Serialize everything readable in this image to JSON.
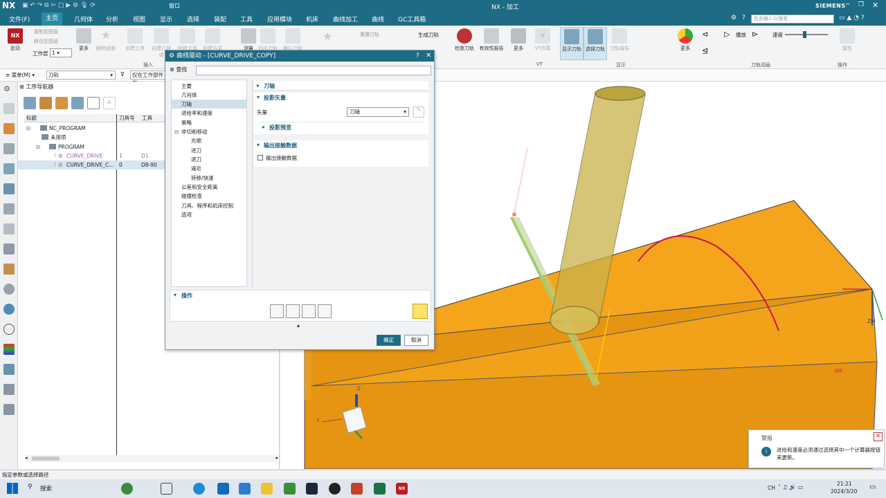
{
  "window": {
    "app_logo": "NX",
    "title": "NX - 加工",
    "brand": "SIEMENS",
    "search_placeholder": "在此输入以搜索",
    "window_menu": "窗口"
  },
  "menu": {
    "items": [
      "文件(F)",
      "主页",
      "几何体",
      "分析",
      "视图",
      "显示",
      "选择",
      "装配",
      "工具",
      "应用模块",
      "机床",
      "曲线加工",
      "曲线",
      "GC工具箱"
    ],
    "active": "主页"
  },
  "ribbon": {
    "launch": "启动",
    "workset_label": "工作层",
    "workset_value": "1",
    "more": "更多",
    "delete_group": "删除组面",
    "copy_plane": "复制至图层",
    "move_plane": "移动至图层",
    "create_op": "创建工序",
    "create_geo": "创建几何体",
    "create_tool": "创建刀具",
    "create_method": "创建方法",
    "measure": "测量",
    "list_op": "列出刀轨",
    "generate_path": "生成刀轨",
    "replay_path": "重播刀轨",
    "verify_path": "确认刀轨",
    "check_tool": "检查刀轨",
    "validity": "有效性报告",
    "more2": "更多",
    "vt_sim": "VT仿真",
    "show_path": "显示刀轨",
    "select_path": "选择刀轨",
    "path_report": "刀轨报告",
    "more3": "更多",
    "play": "播放",
    "speed": "速度",
    "attr": "属性",
    "group_insert": "插入",
    "group_vt": "VT",
    "group_display": "显示",
    "group_animation": "刀轨动画",
    "group_ops": "操作"
  },
  "cmdbar": {
    "menu": "菜单(M)",
    "filter1": "刀轨",
    "filter2": "仅在工作部件内"
  },
  "navigator": {
    "title": "工序导航器",
    "columns": [
      "标题",
      "刀具号",
      "工具"
    ],
    "rows": [
      {
        "name": "NC_PROGRAM",
        "num": "",
        "tool": "",
        "level": 0
      },
      {
        "name": "未用项",
        "num": "",
        "tool": "",
        "level": 1
      },
      {
        "name": "PROGRAM",
        "num": "",
        "tool": "",
        "level": 1
      },
      {
        "name": "CURVE_DRIVE",
        "num": "1",
        "tool": "D1",
        "level": 2
      },
      {
        "name": "CURVE_DRIVE_C...",
        "num": "0",
        "tool": "D8-90",
        "level": 2
      }
    ]
  },
  "dialog": {
    "title": "曲线驱动 - [CURVE_DRIVE_COPY]",
    "find_label": "查找",
    "nav": [
      "主要",
      "几何体",
      "刀轴",
      "进给率和速度",
      "策略",
      "非切削移动",
      "光顺",
      "进刀",
      "退刀",
      "逼近",
      "转移/快速",
      "公差和安全距离",
      "碰撞检查",
      "刀具、程序和机床控制",
      "选项"
    ],
    "nav_selected": "刀轴",
    "sec_tool_axis": "刀轴",
    "sec_proj_vec": "投影矢量",
    "vector_label": "矢量",
    "vector_value": "刀轴",
    "sec_proj_preview": "投影预览",
    "sec_output": "输出接触数据",
    "output_check": "输出接触数据",
    "sec_ops": "操作",
    "ok": "确定",
    "cancel": "取消"
  },
  "viewport": {
    "axis_zm": "ZM",
    "axis_xm": "XM",
    "axis_z": "Z",
    "axis_x": "X"
  },
  "alert": {
    "title": "警报",
    "message": "进给和速度必须通过选择其中一个计算器按钮来更新。"
  },
  "status": {
    "text": "指定参数或选择路径"
  },
  "taskbar": {
    "search": "搜索",
    "ime": "CH",
    "time": "21:21",
    "date": "2024/3/20"
  },
  "colors": {
    "titlebar": "#1d6b84",
    "stock": "#f5a51c",
    "tool": "#d3b84e",
    "curve": "#d0124f"
  }
}
